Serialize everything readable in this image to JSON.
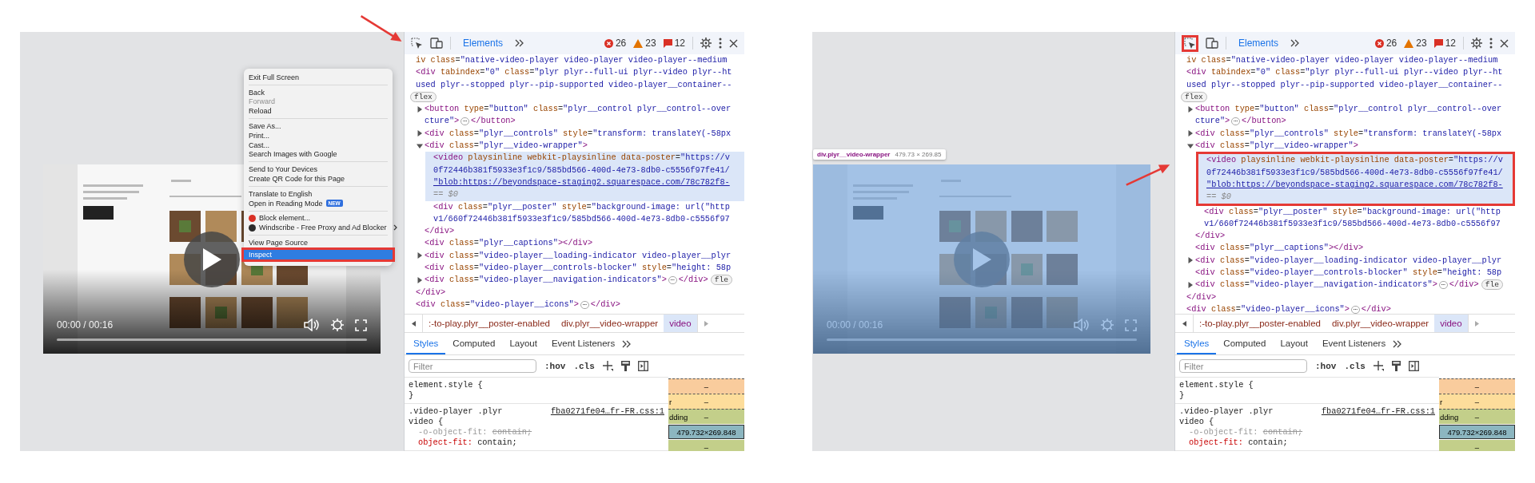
{
  "panels": [
    {
      "callout_arrow": true,
      "page": {
        "video_highlighted": false,
        "time": "00:00 / 00:16",
        "progress": {
          "level": 0
        },
        "context_menu": {
          "groups": [
            [
              {
                "label": "Exit Full Screen",
                "disabled": false,
                "selected": false
              }
            ],
            [
              {
                "label": "Back",
                "disabled": false,
                "selected": false
              },
              {
                "label": "Forward",
                "disabled": true,
                "selected": false
              },
              {
                "label": "Reload",
                "disabled": false,
                "selected": false
              }
            ],
            [
              {
                "label": "Save As...",
                "disabled": false,
                "selected": false
              },
              {
                "label": "Print...",
                "disabled": false,
                "selected": false
              },
              {
                "label": "Cast...",
                "disabled": false,
                "selected": false
              },
              {
                "label": "Search Images with Google",
                "disabled": false,
                "selected": false
              }
            ],
            [
              {
                "label": "Send to Your Devices",
                "disabled": false,
                "selected": false
              },
              {
                "label": "Create QR Code for this Page",
                "disabled": false,
                "selected": false
              }
            ],
            [
              {
                "label": "Translate to English",
                "disabled": false,
                "selected": false
              },
              {
                "label": "Open in Reading Mode",
                "badge": "NEW",
                "disabled": false,
                "selected": false
              }
            ],
            [
              {
                "label": "Block element...",
                "kind": "extension",
                "color": "#d93025",
                "disabled": false,
                "selected": false
              },
              {
                "label": "Windscribe - Free Proxy and Ad Blocker",
                "kind": "extension",
                "color": "#2b2b2b",
                "submenu": true,
                "disabled": false,
                "selected": false
              }
            ],
            [
              {
                "label": "View Page Source",
                "disabled": false,
                "selected": false
              },
              {
                "label": "Inspect",
                "disabled": false,
                "selected": true,
                "annotated": true
              }
            ]
          ]
        }
      },
      "devtools": {
        "toolbar": {
          "inspect_annotated": false,
          "tabs": [
            {
              "label": "Elements",
              "selected": true
            }
          ],
          "errors": "26",
          "warnings": "23",
          "messages": "12"
        },
        "elements": [
          {
            "lines": [
              "iv class=\"native-video-player video-player video-player--medium"
            ],
            "selected": false
          },
          {
            "lines": [
              "<div tabindex=\"0\" class=\"plyr plyr--full-ui plyr--video plyr--ht",
              "used plyr--stopped plyr--pip-supported video-player__container--"
            ],
            "layout_badge": "flex",
            "selected": false,
            "children": [
              {
                "expanded": false,
                "lines": [
                  "<button type=\"button\" class=\"plyr__control plyr__control--over",
                  "cture\">"
                ],
                "ellipsis": "⋯",
                "closing": "</button>",
                "selected": false
              },
              {
                "expanded": false,
                "lines": [
                  "<div class=\"plyr__controls\" style=\"transform: translateY(-58px"
                ],
                "selected": false
              },
              {
                "expanded": true,
                "lines": [
                  "<div class=\"plyr__video-wrapper\">"
                ],
                "selected": false,
                "children": [
                  {
                    "lines": [
                      "<video playsinline webkit-playsinline data-poster=\"https://v",
                      "0f72446b381f5933e3f1c9/585bd566-400d-4e73-8db0-c5556f97fe41/",
                      {
                        "text": "\"blob:https://beyondspace-staging2.squarespace.com/78c782f8-",
                        "kind": "link"
                      }
                    ],
                    "note": "== $0",
                    "selected": true,
                    "annotated": false
                  },
                  {
                    "lines": [
                      "<div class=\"plyr__poster\" style=\"background-image: url(\"http",
                      "v1/660f72446b381f5933e3f1c9/585bd566-400d-4e73-8db0-c5556f97"
                    ],
                    "selected": false
                  }
                ],
                "close": "</div>"
              },
              {
                "lines": [
                  "<div class=\"plyr__captions\"></div>"
                ],
                "selected": false
              },
              {
                "expanded": false,
                "lines": [
                  "<div class=\"video-player__loading-indicator video-player__plyr"
                ],
                "selected": false
              },
              {
                "lines": [
                  "<div class=\"video-player__controls-blocker\" style=\"height: 58p"
                ],
                "selected": false
              },
              {
                "expanded": false,
                "lines": [
                  "<div class=\"video-player__navigation-indicators\">"
                ],
                "ellipsis": "⋯",
                "closing": "</div>",
                "badge": "fle",
                "selected": false
              }
            ],
            "close": "</div>"
          },
          {
            "lines": [
              "<div class=\"video-player__icons\">"
            ],
            "ellipsis": "⋯",
            "closing": "</div>",
            "selected": false
          }
        ],
        "breadcrumbs": [
          {
            "label": ":-to-play.plyr__poster-enabled",
            "selected": false
          },
          {
            "label": "div.plyr__video-wrapper",
            "selected": false
          },
          {
            "label": "video",
            "selected": true
          }
        ],
        "subtabs": [
          {
            "label": "Styles",
            "selected": true
          },
          {
            "label": "Computed",
            "selected": false
          },
          {
            "label": "Layout",
            "selected": false
          },
          {
            "label": "Event Listeners",
            "selected": false
          }
        ],
        "filter": {
          "placeholder": "Filter"
        },
        "hov": ":hov",
        "cls": ".cls",
        "rules": [
          {
            "selector_lines": [
              "element.style {"
            ],
            "close": "}"
          },
          {
            "selector_lines": [
              ".video-player .plyr",
              "video {"
            ],
            "source": "fba0271fe04…fr-FR.css:1",
            "declarations": [
              {
                "property": "-o-object-fit:",
                "value": "contain;",
                "overridden": true
              },
              {
                "property": "object-fit:",
                "value": "contain;",
                "overridden": false
              }
            ]
          }
        ],
        "box_model": {
          "margin": "–",
          "border_label": "r",
          "border": "–",
          "padding_label": "dding",
          "padding": "–",
          "content": "479.732×269.848",
          "padding_bottom": "–"
        }
      }
    },
    {
      "callout_arrow": true,
      "page": {
        "video_highlighted": true,
        "tooltip": {
          "selector": "div.plyr__video-wrapper",
          "size": "479.73 × 269.85"
        },
        "time": "00:00 / 00:16",
        "progress": {
          "level": 0
        }
      },
      "devtools": {
        "toolbar": {
          "inspect_annotated": true,
          "tabs": [
            {
              "label": "Elements",
              "selected": true
            }
          ],
          "errors": "26",
          "warnings": "23",
          "messages": "12"
        },
        "elements": [
          {
            "lines": [
              "iv class=\"native-video-player video-player video-player--medium"
            ],
            "selected": false
          },
          {
            "lines": [
              "<div tabindex=\"0\" class=\"plyr plyr--full-ui plyr--video plyr--ht",
              "used plyr--stopped plyr--pip-supported video-player__container--"
            ],
            "layout_badge": "flex",
            "selected": false,
            "children": [
              {
                "expanded": false,
                "lines": [
                  "<button type=\"button\" class=\"plyr__control plyr__control--over",
                  "cture\">"
                ],
                "ellipsis": "⋯",
                "closing": "</button>",
                "selected": false
              },
              {
                "expanded": false,
                "lines": [
                  "<div class=\"plyr__controls\" style=\"transform: translateY(-58px"
                ],
                "selected": false
              },
              {
                "expanded": true,
                "lines": [
                  "<div class=\"plyr__video-wrapper\">"
                ],
                "selected": false,
                "children": [
                  {
                    "lines": [
                      "<video playsinline webkit-playsinline data-poster=\"https://v",
                      "0f72446b381f5933e3f1c9/585bd566-400d-4e73-8db0-c5556f97fe41/",
                      {
                        "text": "\"blob:https://beyondspace-staging2.squarespace.com/78c782f8-",
                        "kind": "link"
                      }
                    ],
                    "note": "== $0",
                    "selected": true,
                    "annotated": true
                  },
                  {
                    "lines": [
                      "<div class=\"plyr__poster\" style=\"background-image: url(\"http",
                      "v1/660f72446b381f5933e3f1c9/585bd566-400d-4e73-8db0-c5556f97"
                    ],
                    "selected": false
                  }
                ],
                "close": "</div>"
              },
              {
                "lines": [
                  "<div class=\"plyr__captions\"></div>"
                ],
                "selected": false
              },
              {
                "expanded": false,
                "lines": [
                  "<div class=\"video-player__loading-indicator video-player__plyr"
                ],
                "selected": false
              },
              {
                "lines": [
                  "<div class=\"video-player__controls-blocker\" style=\"height: 58p"
                ],
                "selected": false
              },
              {
                "expanded": false,
                "lines": [
                  "<div class=\"video-player__navigation-indicators\">"
                ],
                "ellipsis": "⋯",
                "closing": "</div>",
                "badge": "fle",
                "selected": false
              }
            ],
            "close": "</div>"
          },
          {
            "lines": [
              "<div class=\"video-player__icons\">"
            ],
            "ellipsis": "⋯",
            "closing": "</div>",
            "selected": false
          }
        ],
        "breadcrumbs": [
          {
            "label": ":-to-play.plyr__poster-enabled",
            "selected": false
          },
          {
            "label": "div.plyr__video-wrapper",
            "selected": false
          },
          {
            "label": "video",
            "selected": true
          }
        ],
        "subtabs": [
          {
            "label": "Styles",
            "selected": true
          },
          {
            "label": "Computed",
            "selected": false
          },
          {
            "label": "Layout",
            "selected": false
          },
          {
            "label": "Event Listeners",
            "selected": false
          }
        ],
        "filter": {
          "placeholder": "Filter"
        },
        "hov": ":hov",
        "cls": ".cls",
        "rules": [
          {
            "selector_lines": [
              "element.style {"
            ],
            "close": "}"
          },
          {
            "selector_lines": [
              ".video-player .plyr",
              "video {"
            ],
            "source": "fba0271fe04…fr-FR.css:1",
            "declarations": [
              {
                "property": "-o-object-fit:",
                "value": "contain;",
                "overridden": true
              },
              {
                "property": "object-fit:",
                "value": "contain;",
                "overridden": false
              }
            ]
          }
        ],
        "box_model": {
          "margin": "–",
          "border_label": "r",
          "border": "–",
          "padding_label": "dding",
          "padding": "–",
          "content": "479.732×269.848",
          "padding_bottom": "–"
        }
      }
    }
  ]
}
